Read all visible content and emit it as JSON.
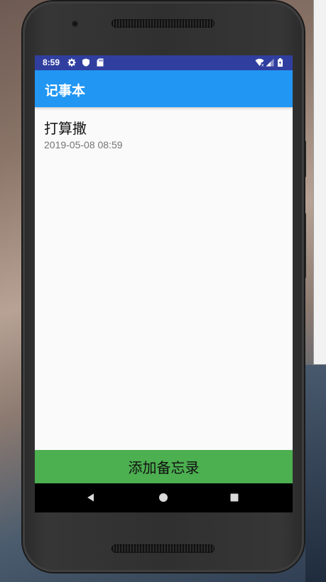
{
  "status_bar": {
    "time": "8:59",
    "color": "#303f9f"
  },
  "app_bar": {
    "title": "记事本",
    "color": "#2196f3"
  },
  "notes": [
    {
      "title": "打算撒",
      "timestamp": "2019-05-08 08:59"
    }
  ],
  "add_button": {
    "label": "添加备忘录",
    "color": "#4caf50"
  },
  "nav_bar": {
    "buttons": [
      "back-icon",
      "home-icon",
      "recents-icon"
    ]
  }
}
